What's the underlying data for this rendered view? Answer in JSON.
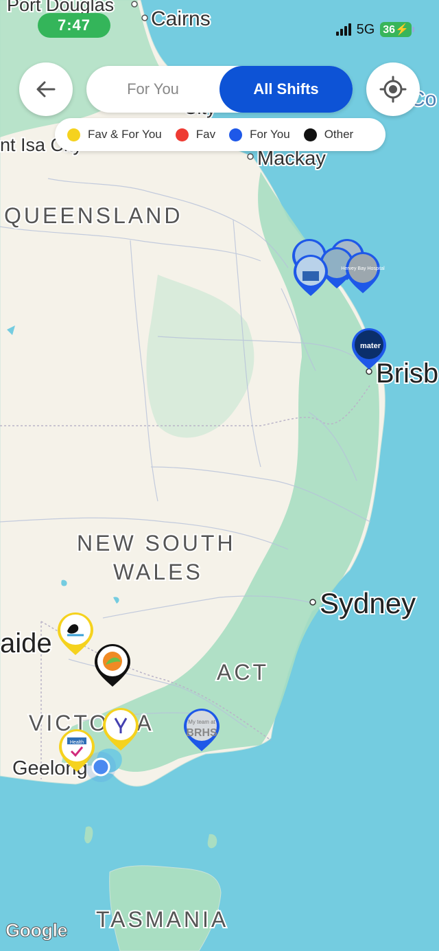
{
  "status_bar": {
    "time": "7:47",
    "network": "5G",
    "battery": "36"
  },
  "toggle": {
    "for_you_label": "For You",
    "all_shifts_label": "All Shifts",
    "selected": "All Shifts"
  },
  "legend": [
    {
      "label": "Fav & For You",
      "color": "#f5d21e"
    },
    {
      "label": "Fav",
      "color": "#ee3b33"
    },
    {
      "label": "For You",
      "color": "#1e58e8"
    },
    {
      "label": "Other",
      "color": "#111111"
    }
  ],
  "map": {
    "provider": "Google",
    "labels": {
      "port_douglas": "Port Douglas",
      "cairns": "Cairns",
      "mount_isa": "nt Isa City",
      "city": "City",
      "mackay": "Mackay",
      "queensland": "QUEENSLAND",
      "brisbane": "Brisb",
      "nsw_line1": "NEW SOUTH",
      "nsw_line2": "WALES",
      "sydney": "Sydney",
      "adelaide": "aide",
      "act": "ACT",
      "victoria": "VICTORIA",
      "geelong": "Geelong",
      "tasmania": "TASMANIA",
      "coast_edge": "Co"
    },
    "pins": {
      "hervey_bay": "Hervey Bay Hospital",
      "mater": "mater",
      "brhs": "BRHS",
      "my_team": "My team at",
      "health": "Health"
    },
    "colors": {
      "ocean": "#74cce0",
      "land": "#f5f2e9",
      "green": "#a9dec2",
      "fav_for_you": "#f5d21e",
      "for_you": "#1e58e8",
      "other": "#111111"
    }
  }
}
